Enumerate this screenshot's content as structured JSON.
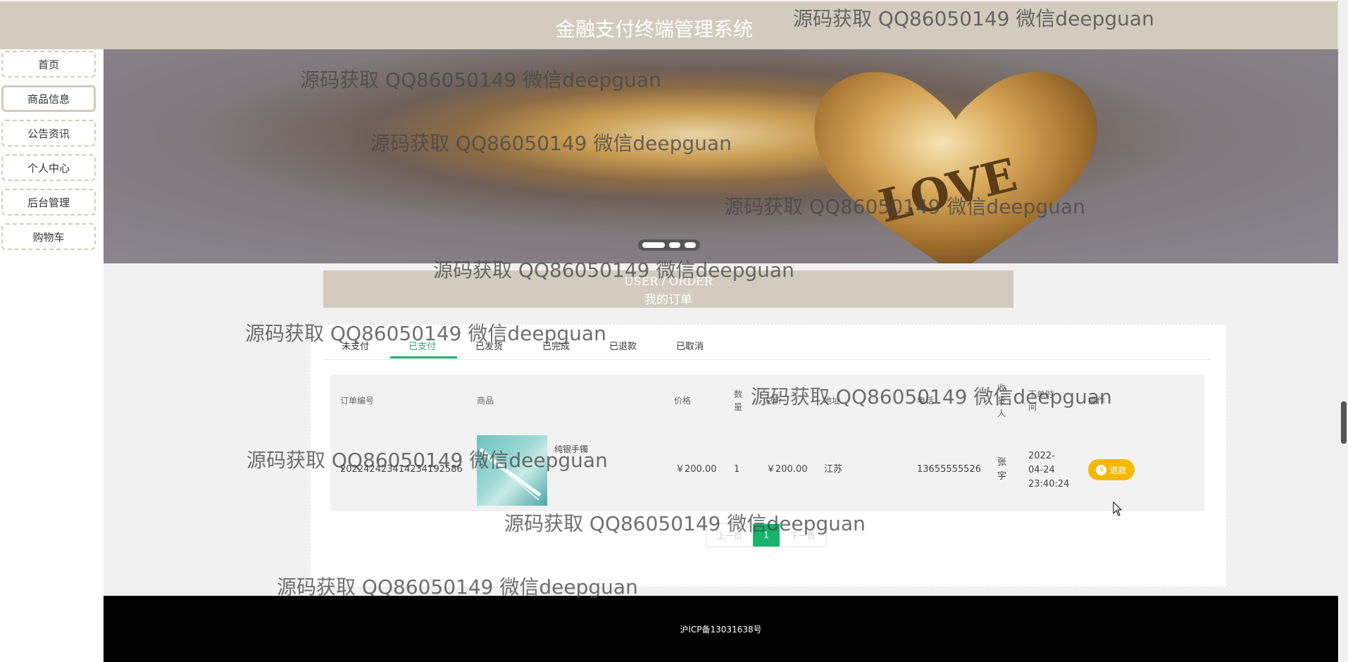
{
  "header": {
    "title": "金融支付终端管理系统"
  },
  "sidebar": {
    "items": [
      {
        "label": "首页",
        "active": false
      },
      {
        "label": "商品信息",
        "active": true
      },
      {
        "label": "公告资讯",
        "active": false
      },
      {
        "label": "个人中心",
        "active": false
      },
      {
        "label": "后台管理",
        "active": false
      },
      {
        "label": "购物车",
        "active": false
      }
    ]
  },
  "banner": {
    "image_text": "LOVE",
    "slide_count": 3,
    "active_slide": 1
  },
  "section": {
    "en": "USER / ORDER",
    "cn": "我的订单"
  },
  "tabs": [
    {
      "label": "未支付"
    },
    {
      "label": "已支付"
    },
    {
      "label": "已发货"
    },
    {
      "label": "已完成"
    },
    {
      "label": "已退款"
    },
    {
      "label": "已取消"
    }
  ],
  "active_tab": "已支付",
  "table": {
    "headers": {
      "order_no": "订单编号",
      "product": "商品",
      "price": "价格",
      "qty": "数量",
      "total": "总价",
      "address": "地址",
      "phone": "电话",
      "recipient": "收货人",
      "time": "下单时间",
      "action": "操作"
    },
    "rows": [
      {
        "order_no": "20224242341423419258 6",
        "order_no_display": "20224242341423419258​6",
        "product_name": "纯银手镯",
        "price": "￥200.00",
        "qty": "1",
        "total": "￥200.00",
        "address": "江苏",
        "phone": "13655555526",
        "recipient": "张宇",
        "time_date": "2022-",
        "time_md": "04-24",
        "time_hms": "23:40:24",
        "action_label": "退款"
      }
    ]
  },
  "pagination": {
    "prev": "上一页",
    "current": "1",
    "next": "下一页"
  },
  "footer": {
    "icp": "沪ICP备13031638号"
  },
  "watermark": "源码获取 QQ86050149 微信deepguan",
  "colors": {
    "header": "#d3cbbd",
    "accent": "#19b36b",
    "refund": "#f5b800",
    "footer": "#000000"
  },
  "icons": {
    "refund": "yen-coin-icon",
    "cursor": "mouse-pointer-icon"
  }
}
